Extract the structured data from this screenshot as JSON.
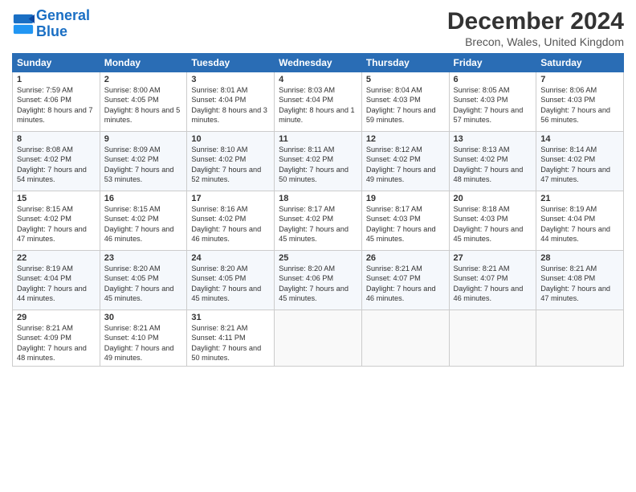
{
  "header": {
    "logo_line1": "General",
    "logo_line2": "Blue",
    "title": "December 2024",
    "subtitle": "Brecon, Wales, United Kingdom"
  },
  "columns": [
    "Sunday",
    "Monday",
    "Tuesday",
    "Wednesday",
    "Thursday",
    "Friday",
    "Saturday"
  ],
  "weeks": [
    [
      {
        "day": "1",
        "rise": "Sunrise: 7:59 AM",
        "set": "Sunset: 4:06 PM",
        "daylight": "Daylight: 8 hours and 7 minutes."
      },
      {
        "day": "2",
        "rise": "Sunrise: 8:00 AM",
        "set": "Sunset: 4:05 PM",
        "daylight": "Daylight: 8 hours and 5 minutes."
      },
      {
        "day": "3",
        "rise": "Sunrise: 8:01 AM",
        "set": "Sunset: 4:04 PM",
        "daylight": "Daylight: 8 hours and 3 minutes."
      },
      {
        "day": "4",
        "rise": "Sunrise: 8:03 AM",
        "set": "Sunset: 4:04 PM",
        "daylight": "Daylight: 8 hours and 1 minute."
      },
      {
        "day": "5",
        "rise": "Sunrise: 8:04 AM",
        "set": "Sunset: 4:03 PM",
        "daylight": "Daylight: 7 hours and 59 minutes."
      },
      {
        "day": "6",
        "rise": "Sunrise: 8:05 AM",
        "set": "Sunset: 4:03 PM",
        "daylight": "Daylight: 7 hours and 57 minutes."
      },
      {
        "day": "7",
        "rise": "Sunrise: 8:06 AM",
        "set": "Sunset: 4:03 PM",
        "daylight": "Daylight: 7 hours and 56 minutes."
      }
    ],
    [
      {
        "day": "8",
        "rise": "Sunrise: 8:08 AM",
        "set": "Sunset: 4:02 PM",
        "daylight": "Daylight: 7 hours and 54 minutes."
      },
      {
        "day": "9",
        "rise": "Sunrise: 8:09 AM",
        "set": "Sunset: 4:02 PM",
        "daylight": "Daylight: 7 hours and 53 minutes."
      },
      {
        "day": "10",
        "rise": "Sunrise: 8:10 AM",
        "set": "Sunset: 4:02 PM",
        "daylight": "Daylight: 7 hours and 52 minutes."
      },
      {
        "day": "11",
        "rise": "Sunrise: 8:11 AM",
        "set": "Sunset: 4:02 PM",
        "daylight": "Daylight: 7 hours and 50 minutes."
      },
      {
        "day": "12",
        "rise": "Sunrise: 8:12 AM",
        "set": "Sunset: 4:02 PM",
        "daylight": "Daylight: 7 hours and 49 minutes."
      },
      {
        "day": "13",
        "rise": "Sunrise: 8:13 AM",
        "set": "Sunset: 4:02 PM",
        "daylight": "Daylight: 7 hours and 48 minutes."
      },
      {
        "day": "14",
        "rise": "Sunrise: 8:14 AM",
        "set": "Sunset: 4:02 PM",
        "daylight": "Daylight: 7 hours and 47 minutes."
      }
    ],
    [
      {
        "day": "15",
        "rise": "Sunrise: 8:15 AM",
        "set": "Sunset: 4:02 PM",
        "daylight": "Daylight: 7 hours and 47 minutes."
      },
      {
        "day": "16",
        "rise": "Sunrise: 8:15 AM",
        "set": "Sunset: 4:02 PM",
        "daylight": "Daylight: 7 hours and 46 minutes."
      },
      {
        "day": "17",
        "rise": "Sunrise: 8:16 AM",
        "set": "Sunset: 4:02 PM",
        "daylight": "Daylight: 7 hours and 46 minutes."
      },
      {
        "day": "18",
        "rise": "Sunrise: 8:17 AM",
        "set": "Sunset: 4:02 PM",
        "daylight": "Daylight: 7 hours and 45 minutes."
      },
      {
        "day": "19",
        "rise": "Sunrise: 8:17 AM",
        "set": "Sunset: 4:03 PM",
        "daylight": "Daylight: 7 hours and 45 minutes."
      },
      {
        "day": "20",
        "rise": "Sunrise: 8:18 AM",
        "set": "Sunset: 4:03 PM",
        "daylight": "Daylight: 7 hours and 45 minutes."
      },
      {
        "day": "21",
        "rise": "Sunrise: 8:19 AM",
        "set": "Sunset: 4:04 PM",
        "daylight": "Daylight: 7 hours and 44 minutes."
      }
    ],
    [
      {
        "day": "22",
        "rise": "Sunrise: 8:19 AM",
        "set": "Sunset: 4:04 PM",
        "daylight": "Daylight: 7 hours and 44 minutes."
      },
      {
        "day": "23",
        "rise": "Sunrise: 8:20 AM",
        "set": "Sunset: 4:05 PM",
        "daylight": "Daylight: 7 hours and 45 minutes."
      },
      {
        "day": "24",
        "rise": "Sunrise: 8:20 AM",
        "set": "Sunset: 4:05 PM",
        "daylight": "Daylight: 7 hours and 45 minutes."
      },
      {
        "day": "25",
        "rise": "Sunrise: 8:20 AM",
        "set": "Sunset: 4:06 PM",
        "daylight": "Daylight: 7 hours and 45 minutes."
      },
      {
        "day": "26",
        "rise": "Sunrise: 8:21 AM",
        "set": "Sunset: 4:07 PM",
        "daylight": "Daylight: 7 hours and 46 minutes."
      },
      {
        "day": "27",
        "rise": "Sunrise: 8:21 AM",
        "set": "Sunset: 4:07 PM",
        "daylight": "Daylight: 7 hours and 46 minutes."
      },
      {
        "day": "28",
        "rise": "Sunrise: 8:21 AM",
        "set": "Sunset: 4:08 PM",
        "daylight": "Daylight: 7 hours and 47 minutes."
      }
    ],
    [
      {
        "day": "29",
        "rise": "Sunrise: 8:21 AM",
        "set": "Sunset: 4:09 PM",
        "daylight": "Daylight: 7 hours and 48 minutes."
      },
      {
        "day": "30",
        "rise": "Sunrise: 8:21 AM",
        "set": "Sunset: 4:10 PM",
        "daylight": "Daylight: 7 hours and 49 minutes."
      },
      {
        "day": "31",
        "rise": "Sunrise: 8:21 AM",
        "set": "Sunset: 4:11 PM",
        "daylight": "Daylight: 7 hours and 50 minutes."
      },
      null,
      null,
      null,
      null
    ]
  ]
}
